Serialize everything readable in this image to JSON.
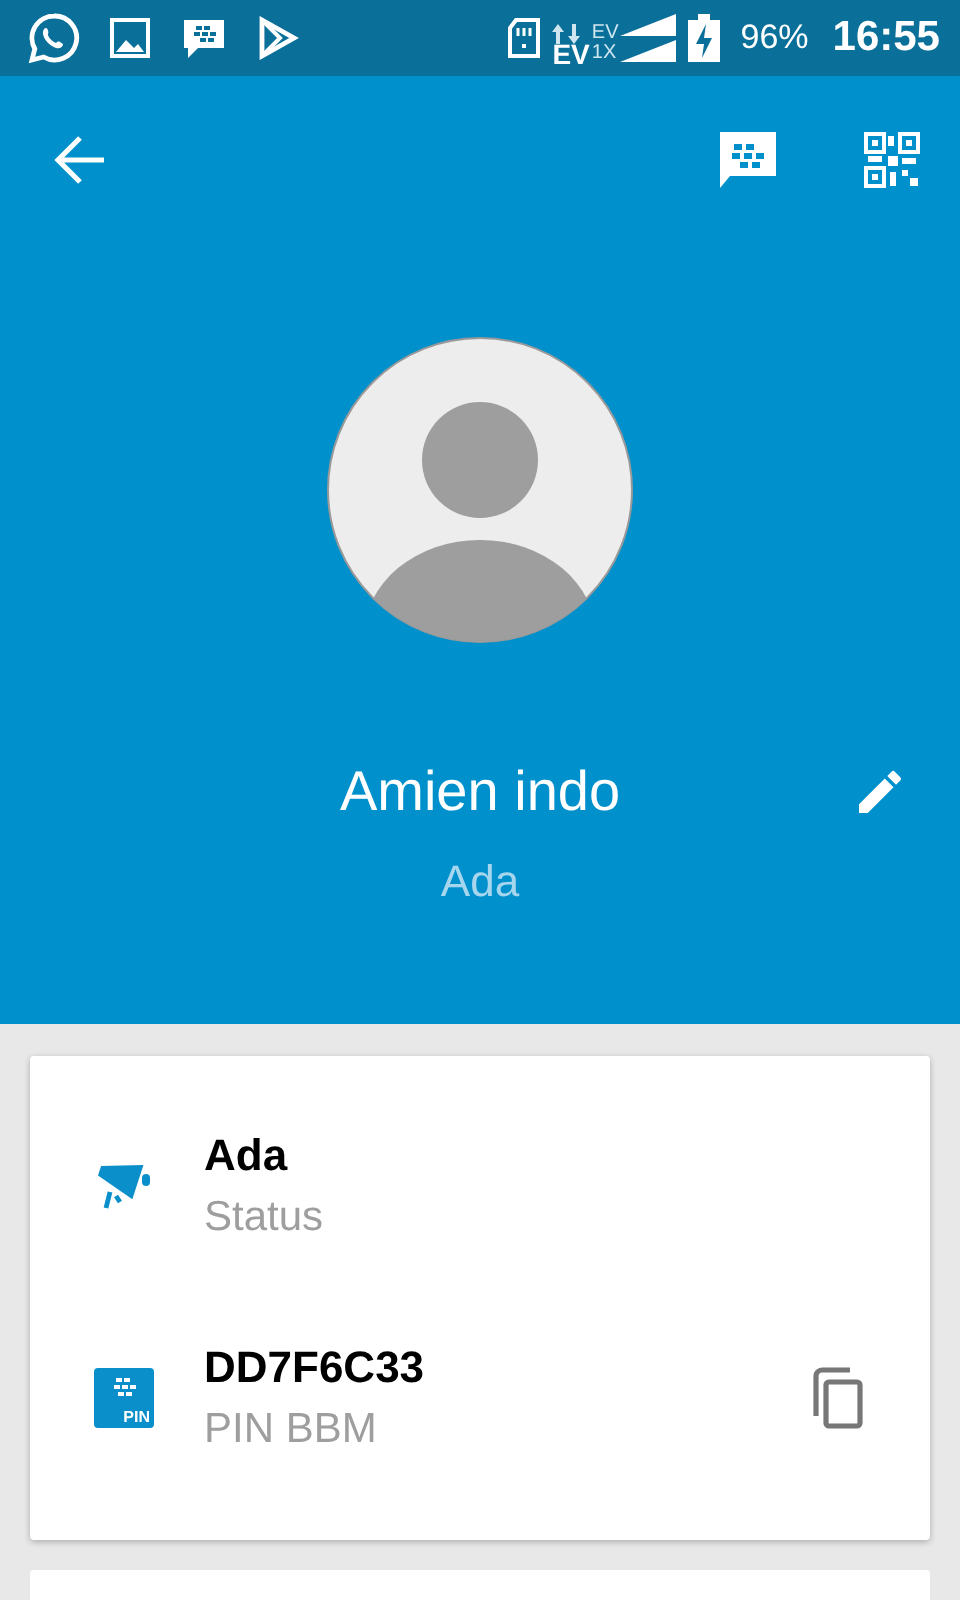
{
  "status_bar": {
    "network_top": "EV",
    "network_main": "EV",
    "network_bottom": "1X",
    "battery": "96%",
    "time": "16:55"
  },
  "profile": {
    "name": "Amien indo",
    "status": "Ada",
    "editable": true
  },
  "details": [
    {
      "kind": "status",
      "title": "Ada",
      "label": "Status",
      "copyable": false
    },
    {
      "kind": "pin",
      "title": "DD7F6C33",
      "label": "PIN BBM",
      "badge": "PIN",
      "copyable": true
    }
  ]
}
